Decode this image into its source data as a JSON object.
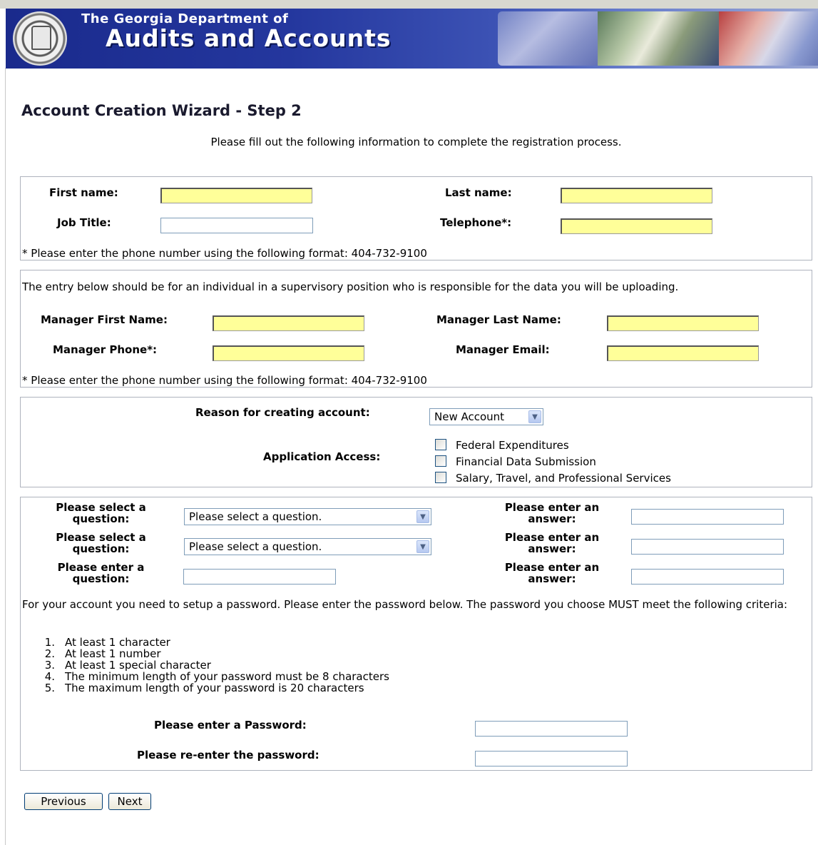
{
  "banner": {
    "small_title": "The Georgia Department of",
    "big_title": "Audits and Accounts"
  },
  "page": {
    "title": "Account Creation Wizard - Step 2",
    "intro": "Please fill out the following information to complete the registration process."
  },
  "personal": {
    "first_name_label": "First name:",
    "last_name_label": "Last name:",
    "job_title_label": "Job Title:",
    "telephone_label": "Telephone*:",
    "phone_note": "* Please enter the phone number using the following format: 404-732-9100"
  },
  "manager": {
    "note": "The entry below should be for an individual in a supervisory position who is responsible for the data you will be uploading.",
    "first_name_label": "Manager First Name:",
    "last_name_label": "Manager Last Name:",
    "phone_label": "Manager Phone*:",
    "email_label": "Manager Email:",
    "phone_note": "* Please enter the phone number using the following format: 404-732-9100"
  },
  "access": {
    "reason_label": "Reason for creating account:",
    "reason_value": "New Account",
    "app_access_label": "Application Access:",
    "options": [
      "Federal Expenditures",
      "Financial Data Submission",
      "Salary, Travel, and Professional Services"
    ]
  },
  "security": {
    "select_question_label": "Please select a question:",
    "enter_question_label": "Please enter a question:",
    "answer_label": "Please enter an answer:",
    "select_placeholder": "Please select a question.",
    "password_intro": "For your account you need to setup a password. Please enter the password below. The password you choose MUST meet the following criteria:",
    "criteria": [
      "At least 1 character",
      "At least 1 number",
      "At least 1 special character",
      "The minimum length of your password must be 8 characters",
      "The maximum length of your password is 20 characters"
    ],
    "password_label": "Please enter a Password:",
    "reenter_label": "Please re-enter the password:"
  },
  "buttons": {
    "previous": "Previous",
    "next": "Next"
  }
}
